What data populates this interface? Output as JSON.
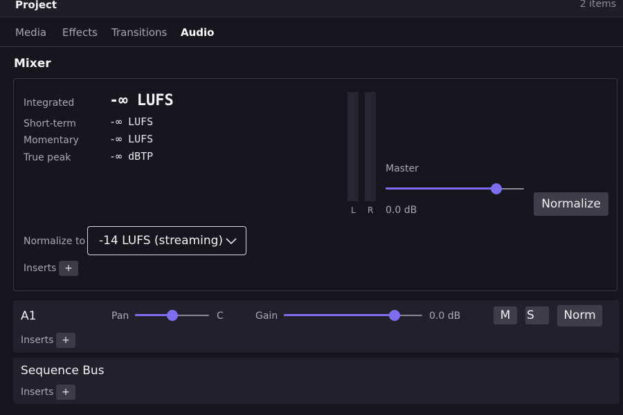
{
  "header": {
    "title": "Project",
    "item_count": "2 items"
  },
  "tabs": [
    {
      "label": "Media",
      "active": false
    },
    {
      "label": "Effects",
      "active": false
    },
    {
      "label": "Transitions",
      "active": false
    },
    {
      "label": "Audio",
      "active": true
    }
  ],
  "mixer": {
    "title": "Mixer",
    "integrated": {
      "label": "Integrated",
      "value": "-∞ LUFS"
    },
    "short_term": {
      "label": "Short-term",
      "value": "-∞ LUFS"
    },
    "momentary": {
      "label": "Momentary",
      "value": "-∞ LUFS"
    },
    "true_peak": {
      "label": "True peak",
      "value": "-∞ dBTP"
    },
    "meter_left_label": "L",
    "meter_right_label": "R",
    "master": {
      "label": "Master",
      "value_text": "0.0 dB",
      "slider_fraction": 0.8
    },
    "normalize_button": "Normalize",
    "normalize_to": {
      "label": "Normalize to",
      "selected": "-14 LUFS (streaming)"
    },
    "inserts": {
      "label": "Inserts",
      "add": "+"
    }
  },
  "tracks": [
    {
      "name": "A1",
      "pan": {
        "label": "Pan",
        "value_text": "C",
        "slider_fraction": 0.5
      },
      "gain": {
        "label": "Gain",
        "value_text": "0.0 dB",
        "slider_fraction": 0.8
      },
      "mute_label": "M",
      "solo_label": "S",
      "norm_label": "Norm",
      "inserts": {
        "label": "Inserts",
        "add": "+"
      }
    },
    {
      "name": "Sequence Bus",
      "inserts": {
        "label": "Inserts",
        "add": "+"
      }
    }
  ],
  "colors": {
    "accent": "#7d6df0",
    "background": "#17161d",
    "panel": "#22212b"
  },
  "icons": {
    "dropdown": "chevron-down-icon",
    "add": "plus-icon"
  }
}
